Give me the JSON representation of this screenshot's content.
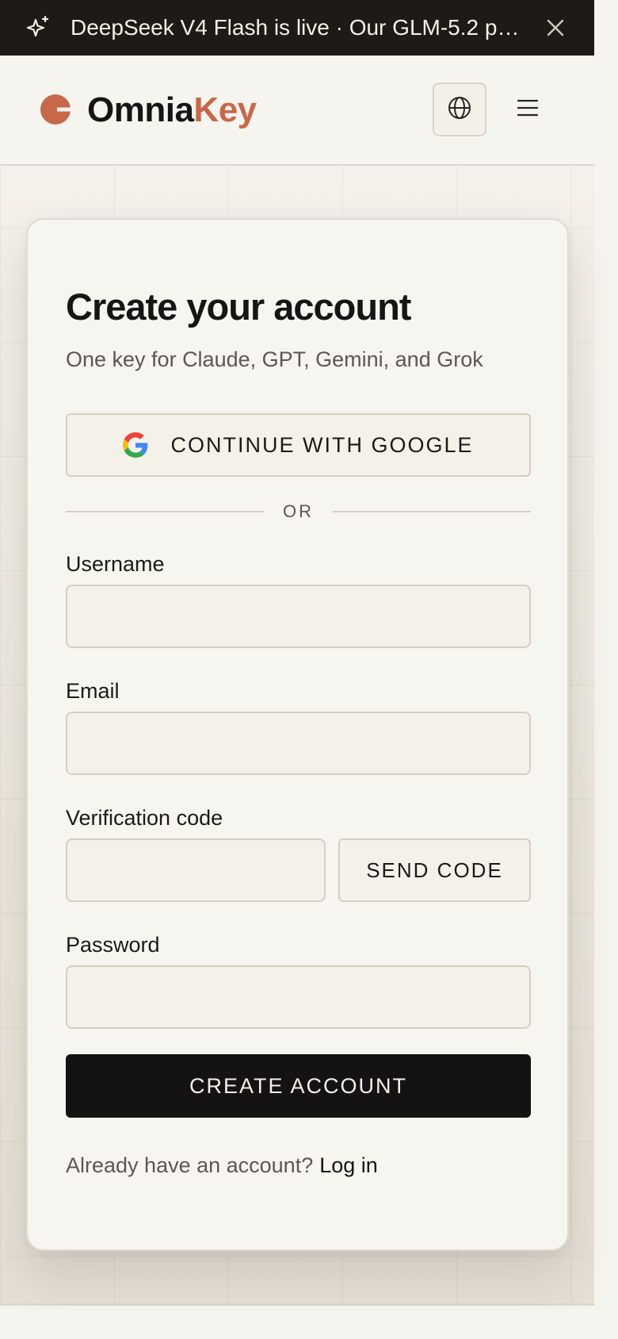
{
  "banner": {
    "message": "DeepSeek V4 Flash is live · Our GLM-5.2 pr…"
  },
  "header": {
    "logo_part1": "Omnia",
    "logo_part2": "Key",
    "brand_color": "#c8684a"
  },
  "form": {
    "title": "Create your account",
    "subtitle": "One key for Claude, GPT, Gemini, and Grok",
    "google_label": "CONTINUE WITH GOOGLE",
    "or_label": "OR",
    "username_label": "Username",
    "username_value": "",
    "email_label": "Email",
    "email_value": "",
    "code_label": "Verification code",
    "code_value": "",
    "send_code_label": "SEND CODE",
    "password_label": "Password",
    "password_value": "",
    "create_label": "CREATE ACCOUNT",
    "login_prompt": "Already have an account?",
    "login_link": "Log in"
  },
  "icons": {
    "banner_icon": "sparkle-icon",
    "close_icon": "close-icon",
    "globe_icon": "globe-icon",
    "menu_icon": "hamburger-menu-icon",
    "google_icon": "google-icon"
  }
}
